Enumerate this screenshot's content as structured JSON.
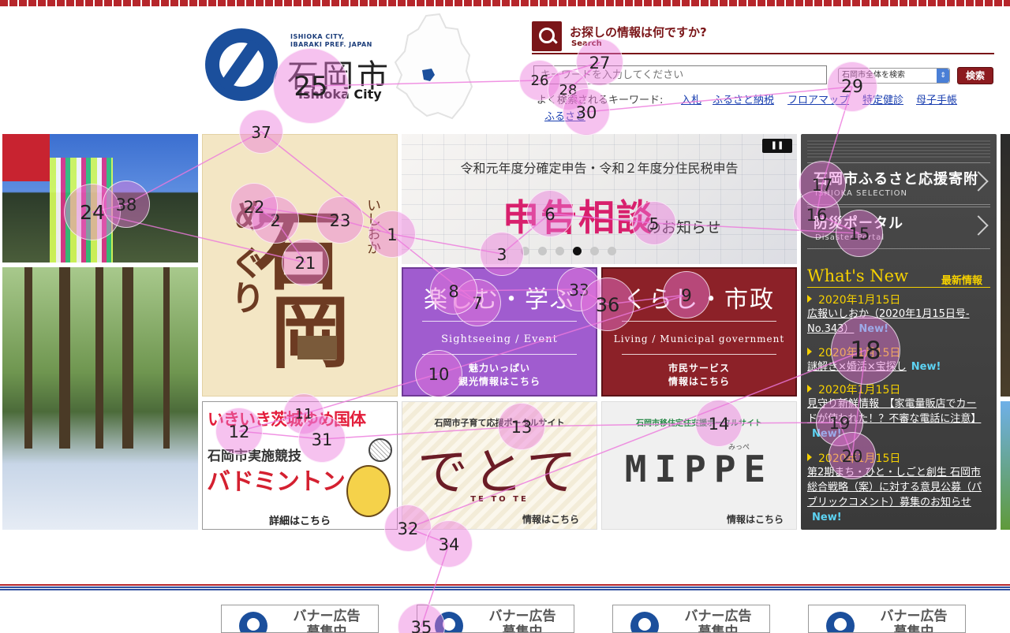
{
  "header": {
    "city_en_small": "ISHIOKA CITY, IBARAKI PREF. JAPAN",
    "city_jp": "石岡市",
    "city_en": "Ishioka City"
  },
  "search": {
    "title": "お探しの情報は何ですか?",
    "subtitle": "Search",
    "placeholder": "キーワードを入力してください",
    "scope_selected": "石岡市全体を検索",
    "button_label": "検索",
    "keywords_label": "よく検索されるキーワード:",
    "keywords": [
      "入札",
      "ふるさと納税",
      "フロアマップ",
      "特定健診",
      "母子手帳",
      "ふるさと"
    ]
  },
  "banners": {
    "meguri": {
      "big1": "石",
      "big2": "岡",
      "small1": "め",
      "small2": "ぐり",
      "vertical": "いしおか"
    },
    "slider": {
      "title": "令和元年度分確定申告・令和２年度分住民税申告",
      "main": "申告相談",
      "sub": "のお知らせ",
      "pause_label": "❚❚",
      "dots_count": 6,
      "active_dot": 3
    },
    "sightseeing": {
      "title": "楽しむ・学ぶ",
      "en": "Sightseeing / Event",
      "line1": "魅力いっぱい",
      "line2": "観光情報はこちら"
    },
    "living": {
      "title": "くらし・市政",
      "en": "Living / Municipal government",
      "line1": "市民サービス",
      "line2": "情報はこちら"
    },
    "kokutai": {
      "title": "いきいき茨城ゆめ国体",
      "sub": "石岡市実施競技",
      "sport": "バドミントン",
      "detail": "詳細はこちら"
    },
    "dete": {
      "head": "石岡市子育て応援ポータルサイト",
      "logo": "でとて",
      "en": "TE TO TE",
      "link": "情報はこちら"
    },
    "mippe": {
      "head": "石岡市移住定住支援ポータルサイト",
      "logo": "MIPPE",
      "kana": "みっぺ",
      "link": "情報はこちら"
    }
  },
  "right_panel": {
    "furusato": {
      "title": "石岡市ふるさと応援寄附",
      "sub": "ISHIOKA SELECTION"
    },
    "bousai": {
      "title": "防災ポータル",
      "sub": "Disaster Portal"
    },
    "whats_new": "What's New",
    "latest_label": "最新情報",
    "new_label": "New!",
    "news": [
      {
        "date": "2020年1月15日",
        "text": "広報いしおか（2020年1月15日号-No.343）"
      },
      {
        "date": "2020年1月15日",
        "text": "謎解き×婚活×宝探し"
      },
      {
        "date": "2020年1月15日",
        "text": "見守り新鮮情報　【家電量販店でカードが使われた！？不審な電話に注意】"
      },
      {
        "date": "2020年1月15日",
        "text": "第2期まち・ひと・しごと創生 石岡市総合戦略（案）に対する意見公募（パブリックコメント）募集のお知らせ"
      }
    ]
  },
  "footer": {
    "ads": [
      {
        "line1": "バナー広告",
        "line2": "募集中"
      },
      {
        "line1": "バナー広告",
        "line2": "募集中"
      },
      {
        "line1": "バナー広告",
        "line2": "募集中"
      },
      {
        "line1": "バナー広告",
        "line2": "募集中"
      }
    ]
  },
  "overlay": {
    "marker_labels": [
      "1",
      "2",
      "3",
      "5",
      "6",
      "7",
      "8",
      "9",
      "10",
      "11",
      "12",
      "13",
      "14",
      "15",
      "16",
      "17",
      "18",
      "19",
      "20",
      "21",
      "22",
      "23",
      "24",
      "25",
      "26",
      "27",
      "28",
      "29",
      "30",
      "31",
      "32",
      "33",
      "34",
      "35",
      "36",
      "37",
      "38"
    ]
  },
  "colors": {
    "brand_blue": "#1b4f9c",
    "accent_red": "#7a1518",
    "purple": "#a05ccf",
    "maroon": "#8c2128",
    "news_yellow": "#f5d000",
    "new_cyan": "#5dd3f3",
    "marker": "#ec78dc"
  }
}
